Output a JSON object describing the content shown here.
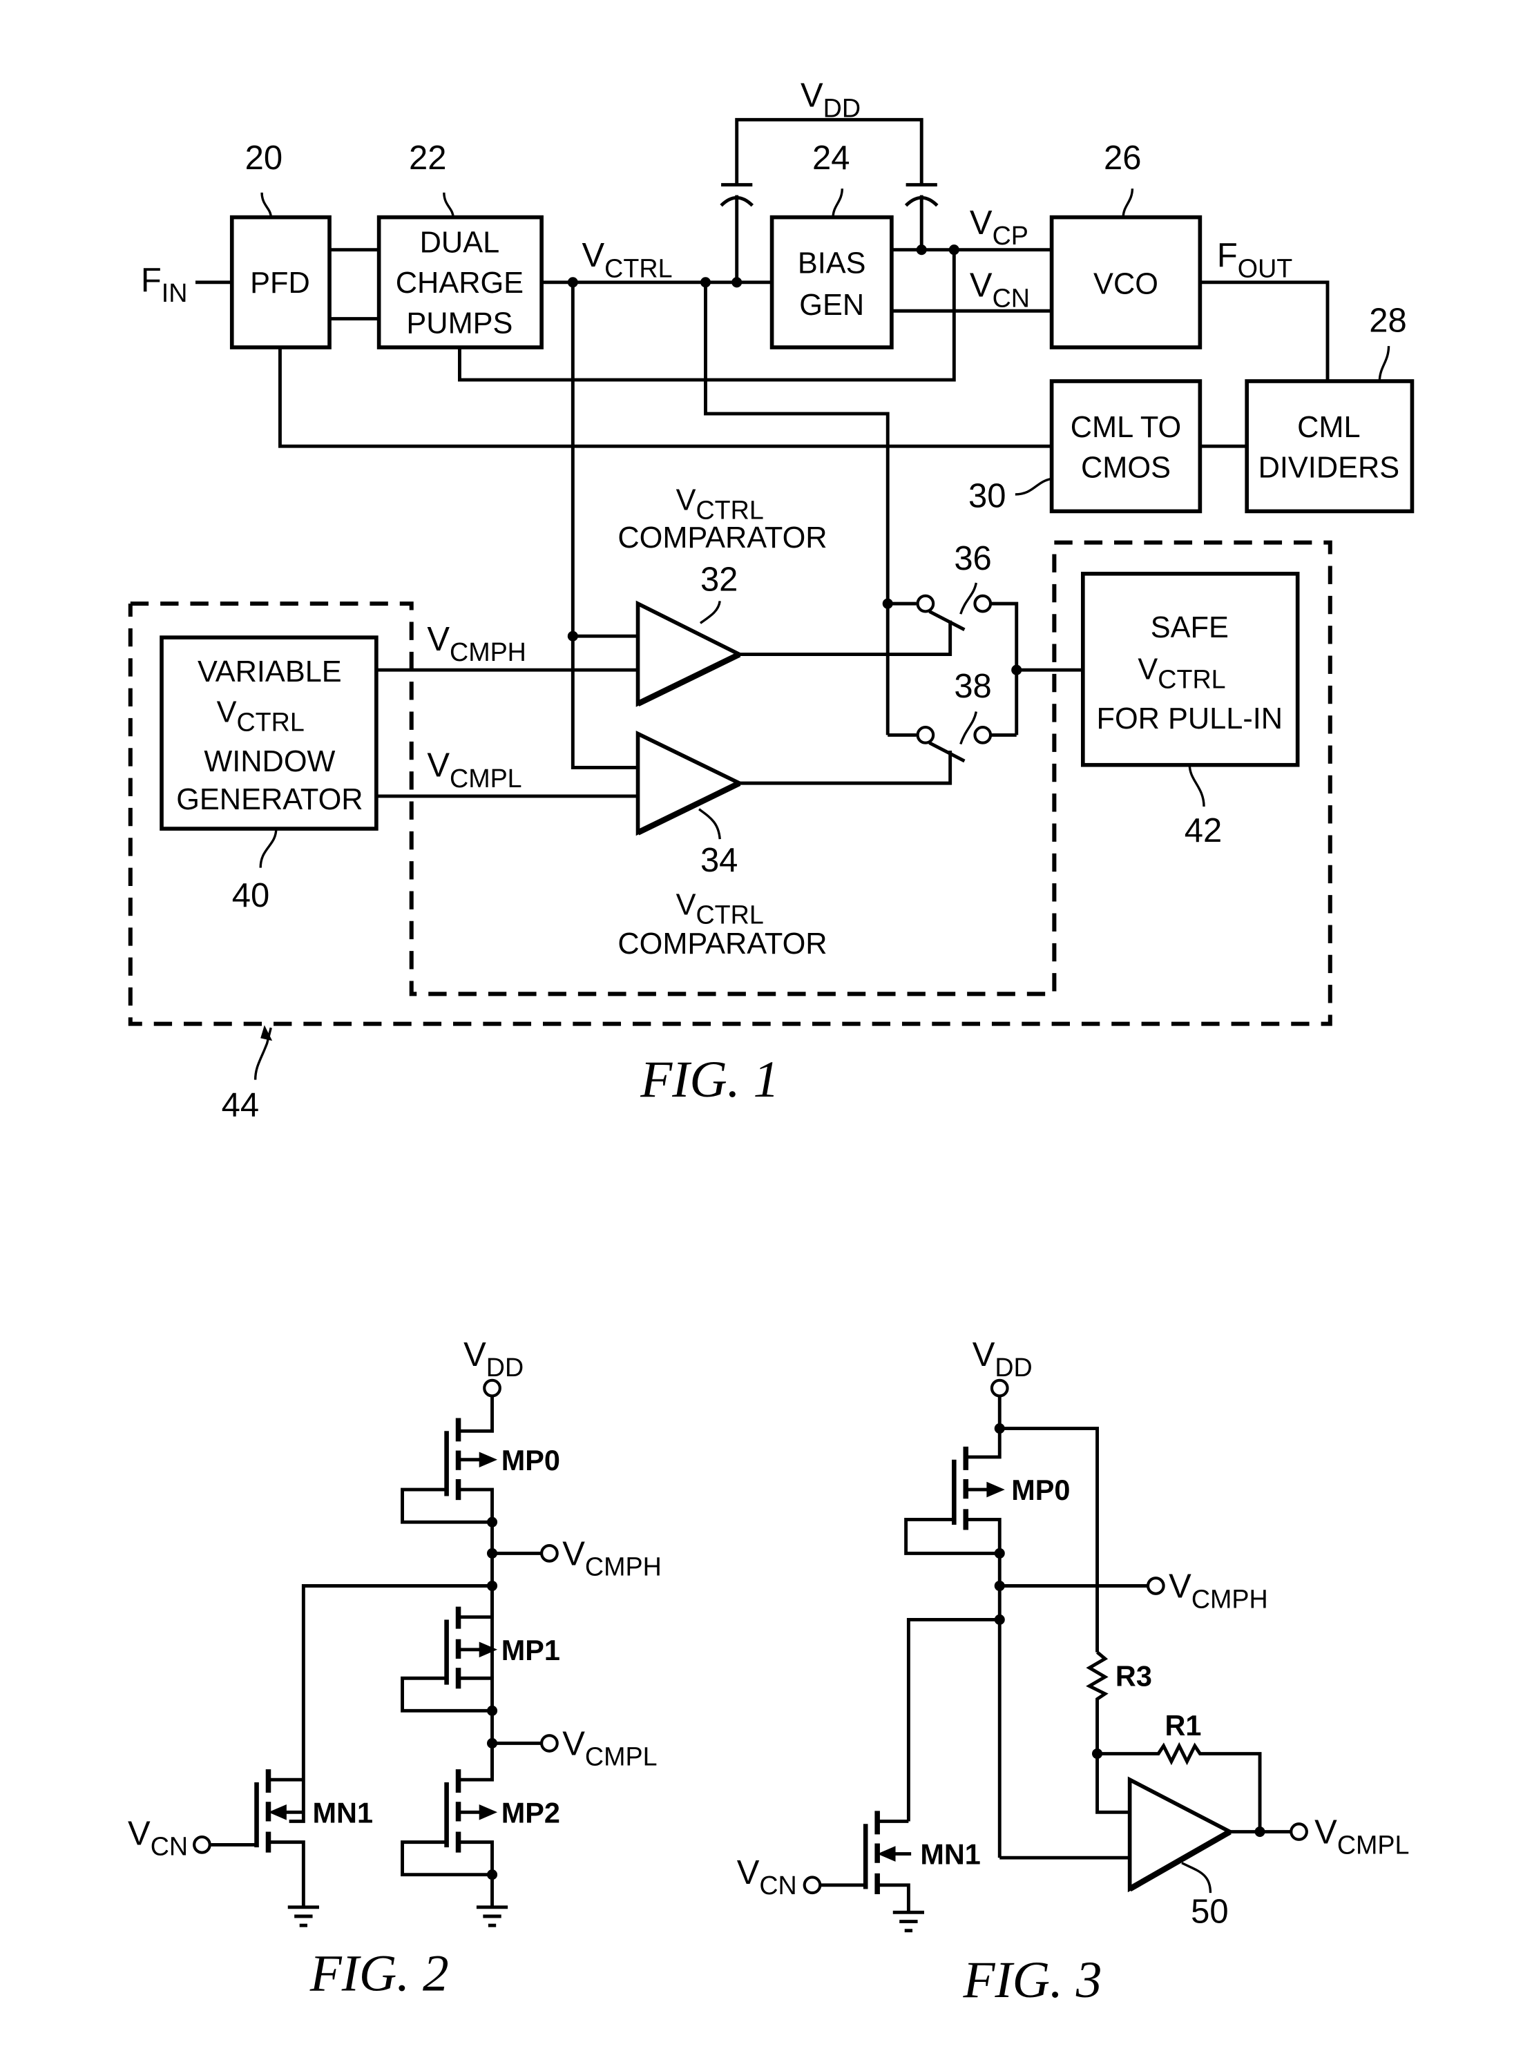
{
  "fig1": {
    "caption": "FIG. 1",
    "input_label": {
      "main": "F",
      "sub": "IN"
    },
    "output_label": {
      "main": "F",
      "sub": "OUT"
    },
    "vdd_label": {
      "main": "V",
      "sub": "DD"
    },
    "vctrl_label": {
      "main": "V",
      "sub": "CTRL"
    },
    "vcp_label": {
      "main": "V",
      "sub": "CP"
    },
    "vcn_label": {
      "main": "V",
      "sub": "CN"
    },
    "vcmph_label": {
      "main": "V",
      "sub": "CMPH"
    },
    "vcmpl_label": {
      "main": "V",
      "sub": "CMPL"
    },
    "blocks": {
      "pfd": {
        "ref": "20",
        "lines": [
          "PFD"
        ]
      },
      "charge_pumps": {
        "ref": "22",
        "lines": [
          "DUAL",
          "CHARGE",
          "PUMPS"
        ]
      },
      "bias_gen": {
        "ref": "24",
        "lines": [
          "BIAS",
          "GEN"
        ]
      },
      "vco": {
        "ref": "26",
        "lines": [
          "VCO"
        ]
      },
      "cml_dividers": {
        "ref": "28",
        "lines": [
          "CML",
          "DIVIDERS"
        ]
      },
      "cml_to_cmos": {
        "ref": "30",
        "lines": [
          "CML TO",
          "CMOS"
        ]
      },
      "window_gen": {
        "ref": "40",
        "lines": [
          "VARIABLE",
          "V",
          "WINDOW",
          "GENERATOR"
        ],
        "sub": "CTRL"
      },
      "safe_vctrl": {
        "ref": "42",
        "lines": [
          "SAFE",
          "V",
          "FOR PULL-IN"
        ],
        "sub": "CTRL"
      }
    },
    "comparator_top": {
      "ref": "32",
      "title_main": "V",
      "title_sub": "CTRL",
      "title_text": "COMPARATOR"
    },
    "comparator_bottom": {
      "ref": "34",
      "title_main": "V",
      "title_sub": "CTRL",
      "title_text": "COMPARATOR"
    },
    "switch_top": {
      "ref": "36"
    },
    "switch_bottom": {
      "ref": "38"
    },
    "enclosure": {
      "ref": "44"
    }
  },
  "fig2": {
    "caption": "FIG. 2",
    "vdd": {
      "main": "V",
      "sub": "DD"
    },
    "vcmph": {
      "main": "V",
      "sub": "CMPH"
    },
    "vcmpl": {
      "main": "V",
      "sub": "CMPL"
    },
    "vcn": {
      "main": "V",
      "sub": "CN"
    },
    "transistors": [
      "MP0",
      "MP1",
      "MP2",
      "MN1"
    ]
  },
  "fig3": {
    "caption": "FIG. 3",
    "vdd": {
      "main": "V",
      "sub": "DD"
    },
    "vcmph": {
      "main": "V",
      "sub": "CMPH"
    },
    "vcmpl": {
      "main": "V",
      "sub": "CMPL"
    },
    "vcn": {
      "main": "V",
      "sub": "CN"
    },
    "transistors": [
      "MP0",
      "MN1"
    ],
    "resistors": [
      "R3",
      "R1"
    ],
    "amplifier_ref": "50"
  }
}
